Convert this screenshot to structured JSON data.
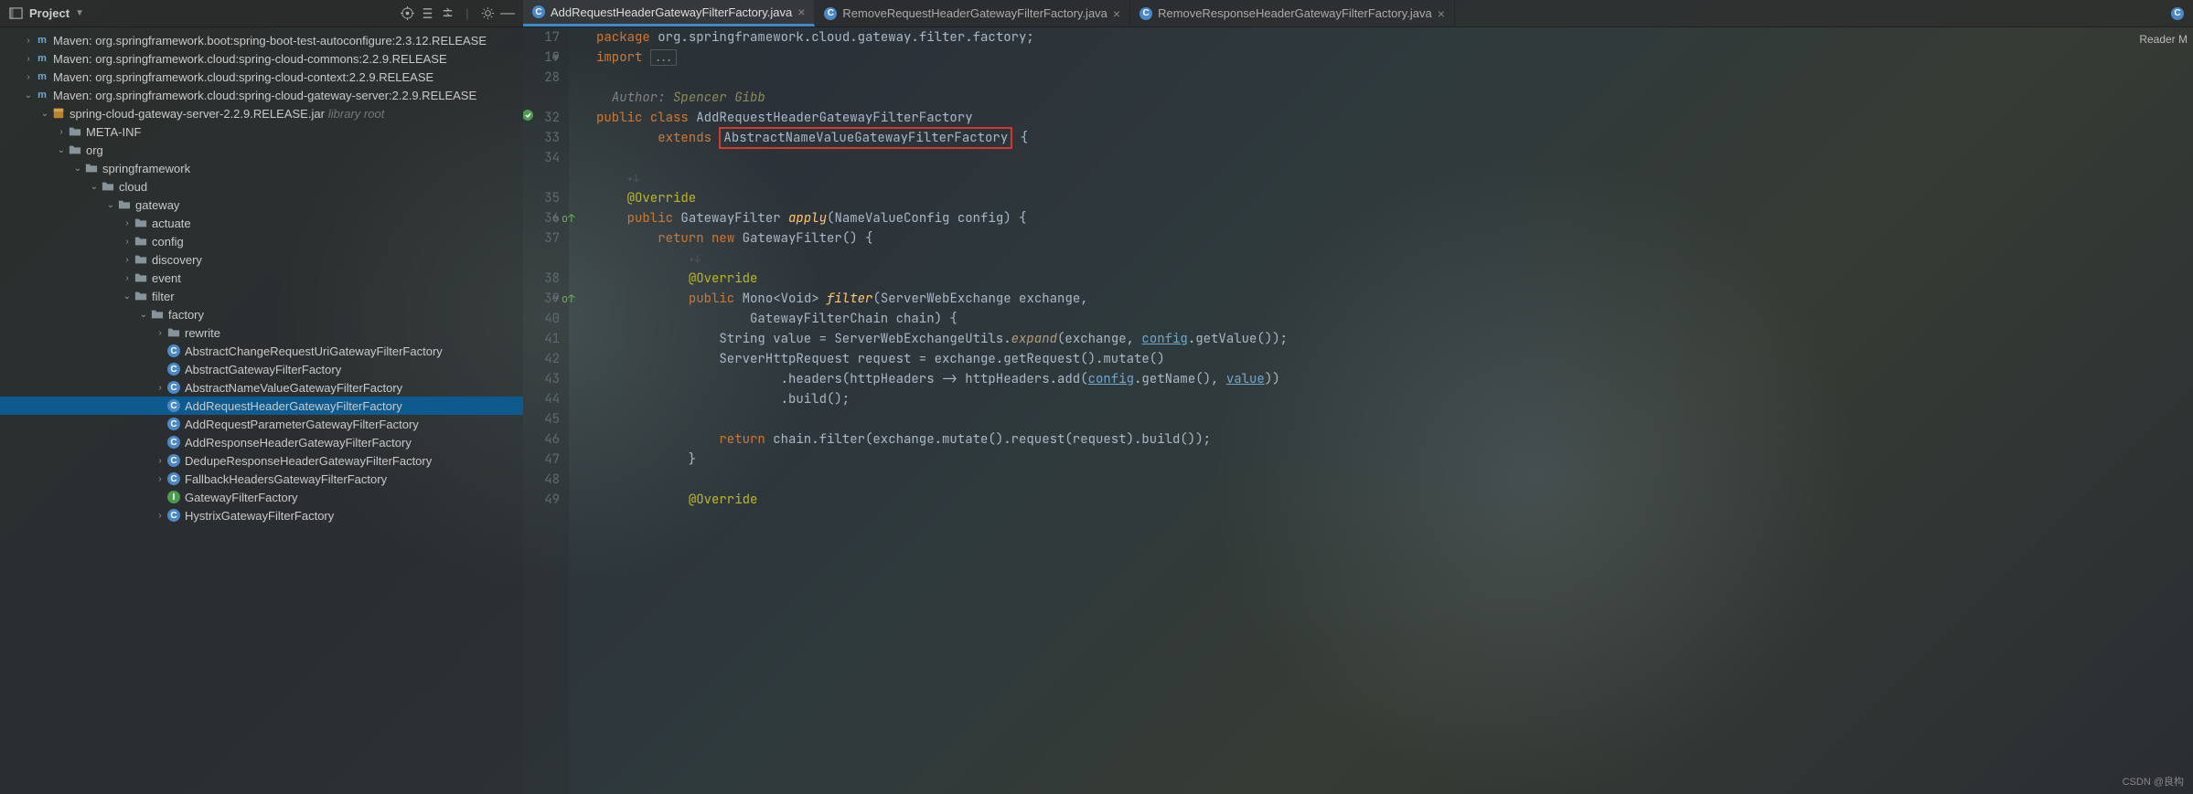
{
  "project_title": "Project",
  "reader_mode": "Reader M",
  "watermark": "CSDN @良构",
  "tabs": [
    {
      "label": "AddRequestHeaderGatewayFilterFactory.java",
      "active": true
    },
    {
      "label": "RemoveRequestHeaderGatewayFilterFactory.java",
      "active": false
    },
    {
      "label": "RemoveResponseHeaderGatewayFilterFactory.java",
      "active": false
    }
  ],
  "tree": [
    {
      "d": 0,
      "a": "r",
      "i": "maven",
      "t": "Maven: org.springframework.boot:spring-boot-test-autoconfigure:2.3.12.RELEASE"
    },
    {
      "d": 0,
      "a": "r",
      "i": "maven",
      "t": "Maven: org.springframework.cloud:spring-cloud-commons:2.2.9.RELEASE"
    },
    {
      "d": 0,
      "a": "r",
      "i": "maven",
      "t": "Maven: org.springframework.cloud:spring-cloud-context:2.2.9.RELEASE"
    },
    {
      "d": 0,
      "a": "d",
      "i": "maven",
      "t": "Maven: org.springframework.cloud:spring-cloud-gateway-server:2.2.9.RELEASE"
    },
    {
      "d": 1,
      "a": "d",
      "i": "jar",
      "t": "spring-cloud-gateway-server-2.2.9.RELEASE.jar",
      "suffix": "library root"
    },
    {
      "d": 2,
      "a": "r",
      "i": "folder",
      "t": "META-INF"
    },
    {
      "d": 2,
      "a": "d",
      "i": "folderopen",
      "t": "org"
    },
    {
      "d": 3,
      "a": "d",
      "i": "folderopen",
      "t": "springframework"
    },
    {
      "d": 4,
      "a": "d",
      "i": "folderopen",
      "t": "cloud"
    },
    {
      "d": 5,
      "a": "d",
      "i": "folderopen",
      "t": "gateway"
    },
    {
      "d": 6,
      "a": "r",
      "i": "folder",
      "t": "actuate"
    },
    {
      "d": 6,
      "a": "r",
      "i": "folder",
      "t": "config"
    },
    {
      "d": 6,
      "a": "r",
      "i": "folder",
      "t": "discovery"
    },
    {
      "d": 6,
      "a": "r",
      "i": "folder",
      "t": "event"
    },
    {
      "d": 6,
      "a": "d",
      "i": "folderopen",
      "t": "filter"
    },
    {
      "d": 7,
      "a": "d",
      "i": "folderopen",
      "t": "factory"
    },
    {
      "d": 8,
      "a": "r",
      "i": "folder",
      "t": "rewrite"
    },
    {
      "d": 8,
      "a": "",
      "i": "class",
      "t": "AbstractChangeRequestUriGatewayFilterFactory"
    },
    {
      "d": 8,
      "a": "",
      "i": "class",
      "t": "AbstractGatewayFilterFactory"
    },
    {
      "d": 8,
      "a": "r",
      "i": "class",
      "t": "AbstractNameValueGatewayFilterFactory"
    },
    {
      "d": 8,
      "a": "",
      "i": "class",
      "t": "AddRequestHeaderGatewayFilterFactory",
      "sel": true
    },
    {
      "d": 8,
      "a": "",
      "i": "class",
      "t": "AddRequestParameterGatewayFilterFactory"
    },
    {
      "d": 8,
      "a": "",
      "i": "class",
      "t": "AddResponseHeaderGatewayFilterFactory"
    },
    {
      "d": 8,
      "a": "r",
      "i": "class",
      "t": "DedupeResponseHeaderGatewayFilterFactory"
    },
    {
      "d": 8,
      "a": "r",
      "i": "class",
      "t": "FallbackHeadersGatewayFilterFactory"
    },
    {
      "d": 8,
      "a": "",
      "i": "iface",
      "t": "GatewayFilterFactory"
    },
    {
      "d": 8,
      "a": "r",
      "i": "class",
      "t": "HystrixGatewayFilterFactory"
    }
  ],
  "gutter": [
    "17",
    "19",
    "28",
    "",
    "32",
    "33",
    "34",
    "",
    "35",
    "36",
    "37",
    "",
    "38",
    "39",
    "40",
    "41",
    "42",
    "43",
    "44",
    "45",
    "46",
    "47",
    "48",
    "49"
  ],
  "code": {
    "l17_pkg": "org.springframework.cloud.gateway.filter.factory",
    "author_label": "Author:",
    "author_name": "Spencer Gibb",
    "class_name": "AddRequestHeaderGatewayFilterFactory",
    "extends_name": "AbstractNameValueGatewayFilterFactory",
    "apply_sig": "apply",
    "nvconfig": "NameValueConfig config",
    "gwfilter": "GatewayFilter",
    "filter_fn": "filter",
    "swe": "ServerWebExchange exchange",
    "gfc": "GatewayFilterChain chain",
    "expand": "expand",
    "config1": "config",
    "getValue": ".getValue())",
    "config2": "config",
    "getName": ".getName(), ",
    "value": "value",
    "build": ".build();",
    "ret2": "return",
    "chain_line": " chain.filter(exchange.mutate().request(request).build());"
  }
}
